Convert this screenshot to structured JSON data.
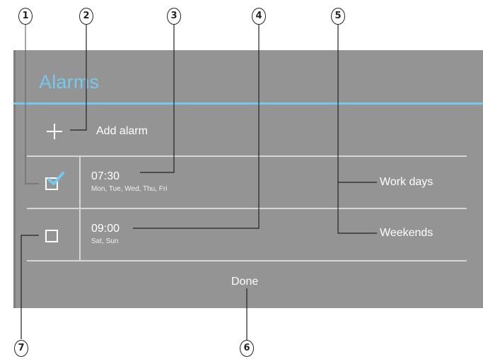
{
  "header": {
    "title": "Alarms"
  },
  "add_alarm": {
    "label": "Add alarm",
    "icon": "plus-icon"
  },
  "alarms": [
    {
      "time": "07:30",
      "days": "Mon, Tue, Wed, Thu, Fri",
      "name": "Work days",
      "checked": true
    },
    {
      "time": "09:00",
      "days": "Sat, Sun",
      "name": "Weekends",
      "checked": false
    }
  ],
  "footer": {
    "done_label": "Done"
  },
  "callouts": [
    "1",
    "2",
    "3",
    "4",
    "5",
    "6",
    "7"
  ],
  "colors": {
    "accent": "#74c9ee",
    "panel": "#949494",
    "divider": "#d6d6d6"
  }
}
